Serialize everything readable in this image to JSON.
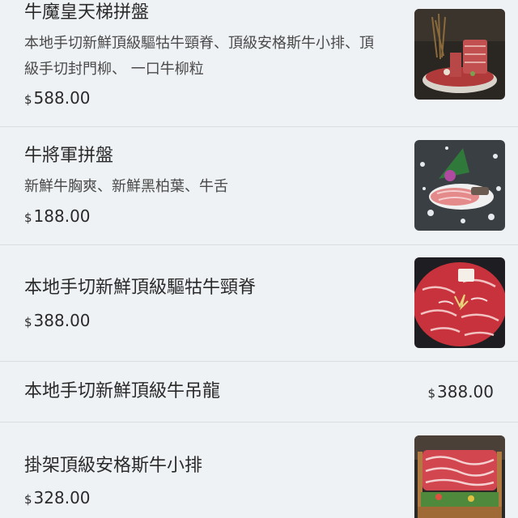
{
  "menu": {
    "items": [
      {
        "name": "牛魔皇天梯拼盤",
        "description": "本地手切新鮮頂級驅牯牛頸脊、頂級安格斯牛小排、頂級手切封門柳、 一口牛柳粒",
        "currency": "$",
        "price": "588.00",
        "has_image": true,
        "image_icon": "beef-tower-platter-photo"
      },
      {
        "name": "牛將軍拼盤",
        "description": "新鮮牛胸爽、新鮮黑柏葉、牛舌",
        "currency": "$",
        "price": "188.00",
        "has_image": true,
        "image_icon": "beef-slices-on-ice-photo"
      },
      {
        "name": "本地手切新鮮頂級驅牯牛頸脊",
        "description": "",
        "currency": "$",
        "price": "388.00",
        "has_image": true,
        "image_icon": "marbled-beef-plate-photo"
      },
      {
        "name": "本地手切新鮮頂級牛吊龍",
        "description": "",
        "currency": "$",
        "price": "388.00",
        "has_image": false
      },
      {
        "name": "掛架頂級安格斯牛小排",
        "description": "",
        "currency": "$",
        "price": "328.00",
        "has_image": true,
        "image_icon": "hanging-beef-rack-photo"
      }
    ]
  },
  "colors": {
    "background": "#eef2f5",
    "divider": "#d9dde1",
    "text": "#2a2a2a",
    "secondary_text": "#4a4a4a"
  }
}
